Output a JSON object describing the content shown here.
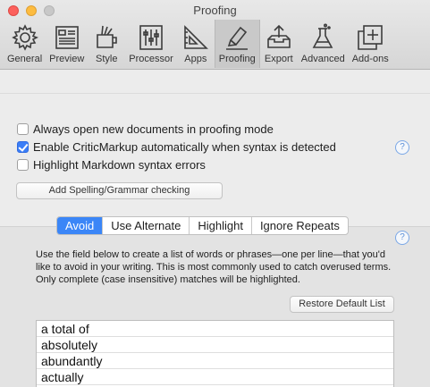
{
  "window": {
    "title": "Proofing"
  },
  "toolbar": {
    "items": [
      {
        "label": "General",
        "icon": "gear-icon"
      },
      {
        "label": "Preview",
        "icon": "preview-icon"
      },
      {
        "label": "Style",
        "icon": "style-icon"
      },
      {
        "label": "Processor",
        "icon": "processor-icon"
      },
      {
        "label": "Apps",
        "icon": "apps-icon"
      },
      {
        "label": "Proofing",
        "icon": "proofing-icon",
        "active": true
      },
      {
        "label": "Export",
        "icon": "export-icon"
      },
      {
        "label": "Advanced",
        "icon": "advanced-icon"
      },
      {
        "label": "Add-ons",
        "icon": "add-ons-icon"
      }
    ]
  },
  "options": {
    "always_open": {
      "label": "Always open  new documents in proofing mode",
      "checked": false
    },
    "criticmarkup": {
      "label": "Enable CriticMarkup automatically when syntax is detected",
      "checked": true
    },
    "highlight_errors": {
      "label": "Highlight Markdown syntax errors",
      "checked": false
    },
    "add_spelling_button": "Add Spelling/Grammar checking",
    "help": "?"
  },
  "tabs": {
    "items": [
      "Avoid",
      "Use Alternate",
      "Highlight",
      "Ignore Repeats"
    ],
    "selected": "Avoid"
  },
  "avoid": {
    "description": "Use the field below to create a list of words or phrases—one per line—that you'd like to avoid in your writing. This is most commonly used to catch overused terms. Only complete (case insensitive) matches will be highlighted.",
    "restore_button": "Restore Default List",
    "help": "?",
    "words": [
      "a total of",
      "absolutely",
      "abundantly",
      "actually"
    ]
  },
  "colors": {
    "accent": "#3b86f7",
    "checkbox_checked": "#3b7ef7"
  }
}
